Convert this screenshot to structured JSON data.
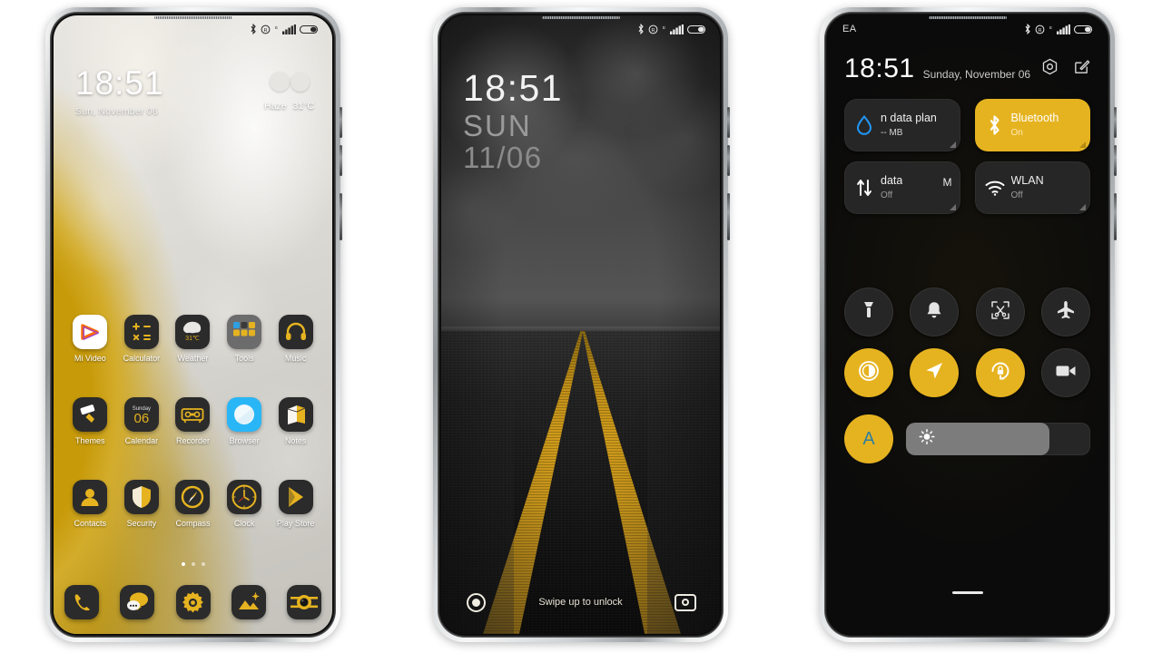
{
  "phone1": {
    "name": "home-screen",
    "statusbar": {
      "icons": [
        "bluetooth-icon",
        "dnd-icon",
        "edge-network-icon",
        "signal-icon",
        "battery-icon"
      ]
    },
    "clock": {
      "time": "18:51",
      "date": "Sun, November 06"
    },
    "weather": {
      "icon": "haze-icon",
      "condition": "Haze",
      "temperature": "31°C"
    },
    "rows": [
      [
        {
          "label": "Mi Video",
          "icon": "mi-video-icon"
        },
        {
          "label": "Calculator",
          "icon": "calculator-icon"
        },
        {
          "label": "Weather",
          "icon": "weather-icon",
          "badge": "31℃"
        },
        {
          "label": "Tools",
          "icon": "tools-folder-icon"
        },
        {
          "label": "Music",
          "icon": "music-icon"
        }
      ],
      [
        {
          "label": "Themes",
          "icon": "themes-icon"
        },
        {
          "label": "Calendar",
          "icon": "calendar-icon",
          "dow": "Sunday",
          "day": "06"
        },
        {
          "label": "Recorder",
          "icon": "recorder-icon"
        },
        {
          "label": "Browser",
          "icon": "browser-icon"
        },
        {
          "label": "Notes",
          "icon": "notes-icon"
        }
      ],
      [
        {
          "label": "Contacts",
          "icon": "contacts-icon"
        },
        {
          "label": "Security",
          "icon": "security-icon"
        },
        {
          "label": "Compass",
          "icon": "compass-icon"
        },
        {
          "label": "Clock",
          "icon": "clock-icon"
        },
        {
          "label": "Play Store",
          "icon": "play-store-icon"
        }
      ]
    ],
    "page_dots": {
      "count": 3,
      "active": 0
    },
    "dock": [
      {
        "label": "Phone",
        "icon": "phone-icon"
      },
      {
        "label": "Messages",
        "icon": "messages-icon"
      },
      {
        "label": "Settings",
        "icon": "settings-gear-icon"
      },
      {
        "label": "Gallery",
        "icon": "gallery-icon"
      },
      {
        "label": "Camera",
        "icon": "camera-icon"
      }
    ]
  },
  "phone2": {
    "name": "lock-screen",
    "statusbar": {
      "icons": [
        "bluetooth-icon",
        "dnd-icon",
        "edge-network-icon",
        "signal-icon",
        "battery-icon"
      ]
    },
    "clock": {
      "time": "18:51",
      "weekday": "SUN",
      "date": "11/06"
    },
    "unlock_hint": "Swipe up to unlock",
    "left_shortcut": "assistant-icon",
    "right_shortcut": "camera-icon"
  },
  "phone3": {
    "name": "control-center",
    "statusbar": {
      "carrier": "EA",
      "icons": [
        "bluetooth-icon",
        "dnd-icon",
        "edge-network-icon",
        "signal-icon",
        "battery-icon"
      ]
    },
    "header": {
      "time": "18:51",
      "date": "Sunday, November 06",
      "settings_icon": "settings-hex-icon",
      "edit_icon": "edit-icon"
    },
    "tiles": [
      {
        "title": "n data plan",
        "subtitle": "-- MB",
        "icon": "data-drop-icon",
        "on": false,
        "badge": ""
      },
      {
        "title": "Bluetooth",
        "subtitle": "On",
        "icon": "bluetooth-icon",
        "on": true,
        "badge": ""
      },
      {
        "title": "data",
        "subtitle": "Off",
        "icon": "mobile-data-icon",
        "on": false,
        "badge": "M"
      },
      {
        "title": "WLAN",
        "subtitle": "Off",
        "icon": "wifi-icon",
        "on": false,
        "badge": ""
      }
    ],
    "toggles": [
      {
        "name": "flashlight-toggle",
        "icon": "flashlight-icon",
        "on": false
      },
      {
        "name": "silent-toggle",
        "icon": "bell-icon",
        "on": false
      },
      {
        "name": "screenshot-toggle",
        "icon": "screenshot-scissors-icon",
        "on": false
      },
      {
        "name": "airplane-mode-toggle",
        "icon": "airplane-icon",
        "on": false
      },
      {
        "name": "dark-mode-toggle",
        "icon": "contrast-icon",
        "on": true
      },
      {
        "name": "location-toggle",
        "icon": "location-arrow-icon",
        "on": true
      },
      {
        "name": "rotation-lock-toggle",
        "icon": "rotation-lock-icon",
        "on": true
      },
      {
        "name": "screen-recorder-toggle",
        "icon": "video-camera-icon",
        "on": false
      }
    ],
    "brightness": {
      "auto_label": "A",
      "auto_on": true,
      "icon": "sun-icon",
      "level_percent": 78
    }
  },
  "colors": {
    "accent": "#e6b320",
    "tile_bg": "#262626",
    "screen_bg": "#0b0b0b",
    "bluetooth_blue": "#2f7f9e"
  }
}
